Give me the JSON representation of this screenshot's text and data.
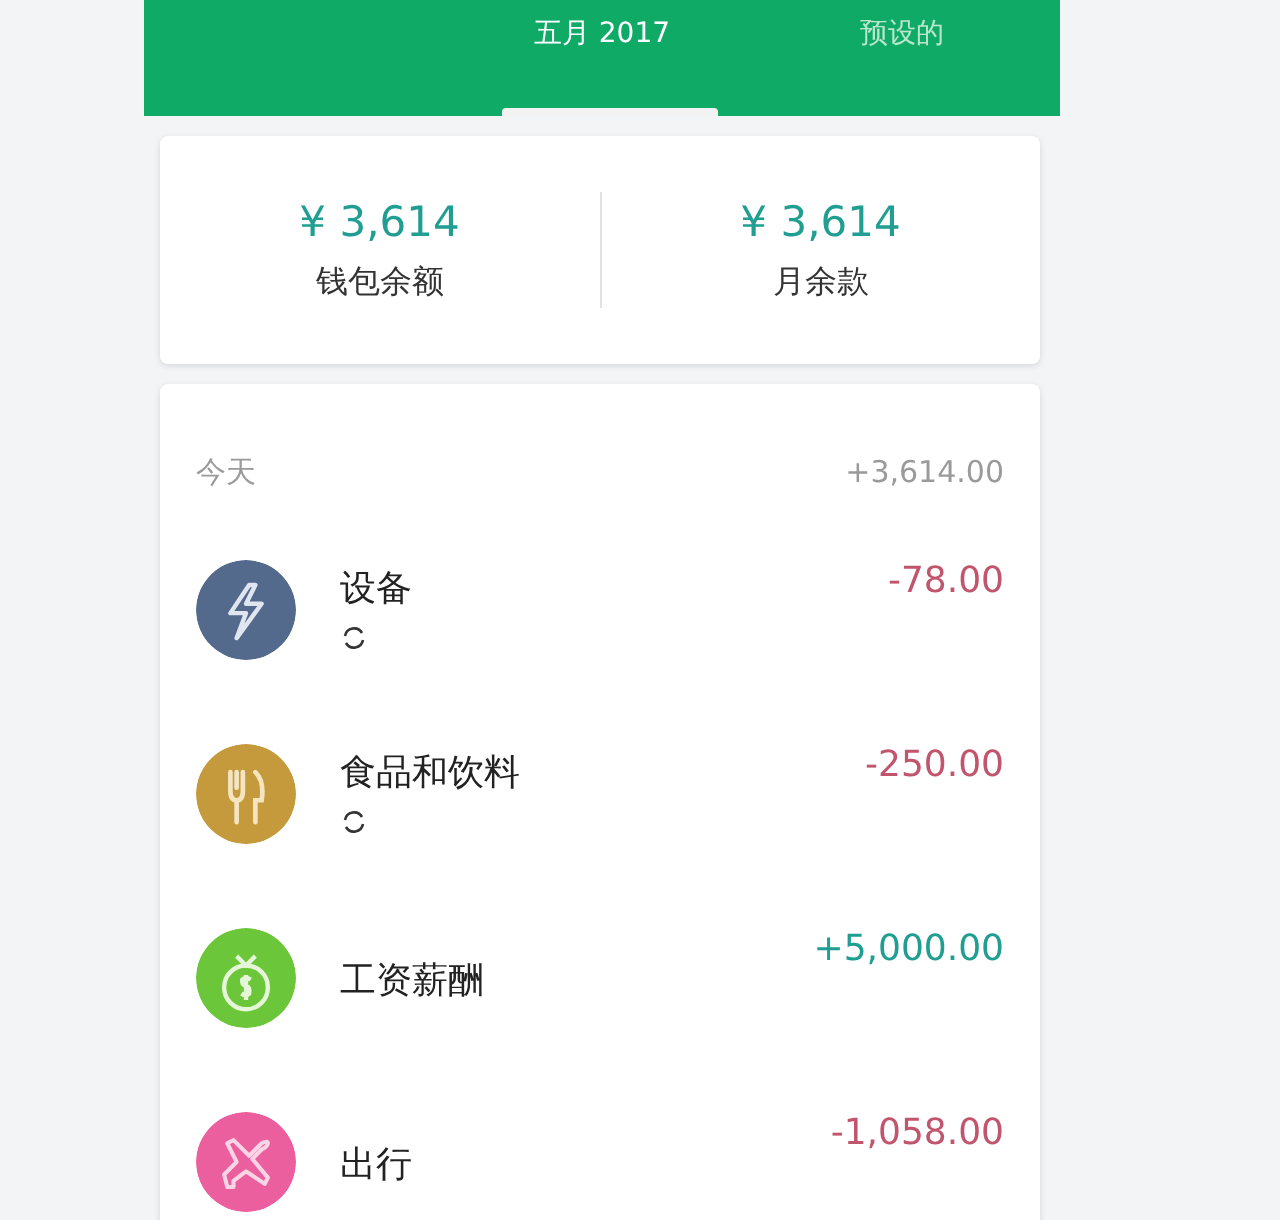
{
  "tabs": [
    {
      "label": "五月 2017",
      "selected": true
    },
    {
      "label": "预设的",
      "selected": false
    }
  ],
  "summary": [
    {
      "amount": "¥ 3,614",
      "label": "钱包余额"
    },
    {
      "amount": "¥ 3,614",
      "label": "月余款"
    }
  ],
  "day": {
    "label": "今天",
    "total": "+3,614.00"
  },
  "transactions": [
    {
      "name": "设备",
      "amount": "-78.00",
      "kind": "expense",
      "recurring": true,
      "color": "#536a8c"
    },
    {
      "name": "食品和饮料",
      "amount": "-250.00",
      "kind": "expense",
      "recurring": true,
      "color": "#c49a3c"
    },
    {
      "name": "工资薪酬",
      "amount": "+5,000.00",
      "kind": "income",
      "recurring": false,
      "color": "#6cc63a"
    },
    {
      "name": "出行",
      "amount": "-1,058.00",
      "kind": "expense",
      "recurring": false,
      "color": "#ec5f9e"
    }
  ]
}
